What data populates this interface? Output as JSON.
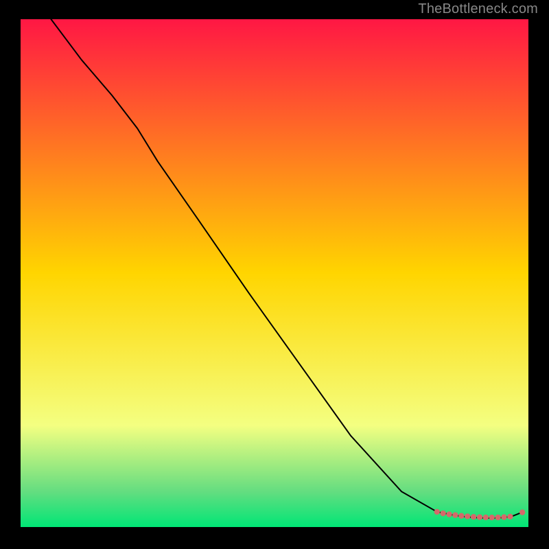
{
  "watermark": "TheBottleneck.com",
  "chart_data": {
    "type": "line",
    "title": "",
    "xlabel": "",
    "ylabel": "",
    "xlim": [
      0,
      100
    ],
    "ylim": [
      0,
      100
    ],
    "grid": false,
    "legend": false,
    "gradient_stops": [
      {
        "offset": 0.0,
        "color": "#ff1744"
      },
      {
        "offset": 0.5,
        "color": "#ffd500"
      },
      {
        "offset": 0.8,
        "color": "#f4ff81"
      },
      {
        "offset": 0.93,
        "color": "#64dd80"
      },
      {
        "offset": 1.0,
        "color": "#00e676"
      }
    ],
    "series": [
      {
        "name": "main-curve",
        "color": "#000000",
        "stroke_width": 2,
        "x": [
          6,
          12,
          18,
          23,
          27,
          35,
          45,
          55,
          65,
          75,
          82,
          85,
          87,
          89,
          91,
          92.5,
          94,
          95.5,
          97,
          99
        ],
        "y": [
          100,
          92,
          85,
          78.5,
          72,
          60.5,
          46,
          32,
          18,
          7,
          3,
          2.4,
          2.1,
          1.9,
          1.8,
          1.75,
          1.8,
          1.9,
          2.2,
          3
        ]
      },
      {
        "name": "highlight-dots",
        "type": "scatter",
        "color": "#d46a6a",
        "radius": 4.2,
        "x": [
          82.0,
          83.2,
          84.4,
          85.6,
          86.8,
          88.0,
          89.2,
          90.4,
          91.6,
          92.8,
          94.0,
          95.2,
          96.4,
          98.8
        ],
        "y": [
          3.0,
          2.7,
          2.5,
          2.35,
          2.2,
          2.1,
          2.0,
          1.95,
          1.9,
          1.88,
          1.9,
          1.95,
          2.05,
          2.9
        ]
      }
    ]
  }
}
